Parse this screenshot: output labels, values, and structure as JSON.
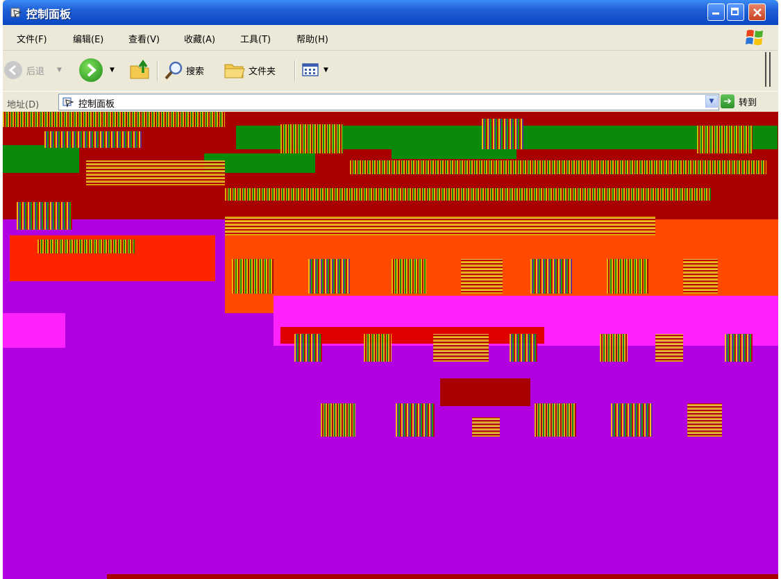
{
  "window": {
    "title": "控制面板",
    "icon": "control-panel-icon",
    "buttons": {
      "minimize": "minimize-icon",
      "maximize": "maximize-icon",
      "close": "close-icon"
    }
  },
  "menu": {
    "items": [
      {
        "label": "文件(F)"
      },
      {
        "label": "编辑(E)"
      },
      {
        "label": "查看(V)"
      },
      {
        "label": "收藏(A)"
      },
      {
        "label": "工具(T)"
      },
      {
        "label": "帮助(H)"
      }
    ]
  },
  "toolbar": {
    "back_label": "后退",
    "search_label": "搜索",
    "folders_label": "文件夹"
  },
  "address": {
    "label": "地址(D)",
    "value": "控制面板",
    "go_label": "转到"
  },
  "colors": {
    "titlebar": "#0a47c4",
    "chrome": "#ece9d8",
    "content_bg": "#b200e0",
    "red_band": "#a80000",
    "orange_band": "#ff4a00",
    "magenta_band": "#ff22ff",
    "green_band": "#0a8a0a"
  }
}
